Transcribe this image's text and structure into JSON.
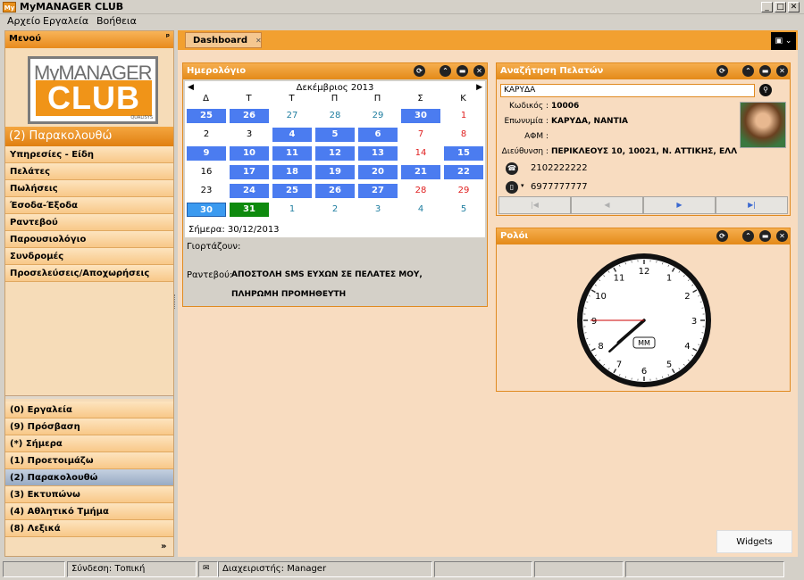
{
  "app": {
    "title": "MyMANAGER CLUB",
    "logo_badge": "My"
  },
  "window_controls": {
    "minimize": "_",
    "maximize": "□",
    "close": "✕"
  },
  "menubar": {
    "items": [
      "Αρχείο",
      "Εργαλεία",
      "Βοήθεια"
    ]
  },
  "sidebar": {
    "title": "Μενού",
    "pin": "ᵖ",
    "logo": {
      "my": "MyMANAGER",
      "club": "CLUB",
      "small": "QUALISYS"
    },
    "section_title": "(2) Παρακολουθώ",
    "items": [
      "Υπηρεσίες - Είδη",
      "Πελάτες",
      "Πωλήσεις",
      "Έσοδα-Έξοδα",
      "Ραντεβού",
      "Παρουσιολόγιο",
      "Συνδρομές",
      "Προσελεύσεις/Αποχωρήσεις"
    ],
    "groups": [
      "(0) Εργαλεία",
      "(9) Πρόσβαση",
      "(*) Σήμερα",
      "(1) Προετοιμάζω",
      "(2) Παρακολουθώ",
      "(3) Εκτυπώνω",
      "(4) Αθλητικό Τμήμα",
      "(8) Λεξικά"
    ],
    "selected_group": "(2) Παρακολουθώ",
    "more": "»"
  },
  "tabs": {
    "active": "Dashboard",
    "close": "✕",
    "menu": "▣ ⌄"
  },
  "calendar": {
    "title": "Ημερολόγιο",
    "month": "Δεκέμβριος 2013",
    "prev": "◀",
    "next": "▶",
    "days_of_week": [
      "Δ",
      "Τ",
      "Τ",
      "Π",
      "Π",
      "Σ",
      "Κ"
    ],
    "weeks": [
      [
        {
          "d": "25",
          "s": "b"
        },
        {
          "d": "26",
          "s": "b"
        },
        {
          "d": "27",
          "s": "teal"
        },
        {
          "d": "28",
          "s": "teal"
        },
        {
          "d": "29",
          "s": "teal"
        },
        {
          "d": "30",
          "s": "b"
        },
        {
          "d": "1",
          "s": "red"
        }
      ],
      [
        {
          "d": "2",
          "s": ""
        },
        {
          "d": "3",
          "s": ""
        },
        {
          "d": "4",
          "s": "b"
        },
        {
          "d": "5",
          "s": "b"
        },
        {
          "d": "6",
          "s": "b"
        },
        {
          "d": "7",
          "s": "red"
        },
        {
          "d": "8",
          "s": "red"
        }
      ],
      [
        {
          "d": "9",
          "s": "b"
        },
        {
          "d": "10",
          "s": "b"
        },
        {
          "d": "11",
          "s": "b"
        },
        {
          "d": "12",
          "s": "b"
        },
        {
          "d": "13",
          "s": "b"
        },
        {
          "d": "14",
          "s": "red"
        },
        {
          "d": "15",
          "s": "b"
        }
      ],
      [
        {
          "d": "16",
          "s": ""
        },
        {
          "d": "17",
          "s": "b"
        },
        {
          "d": "18",
          "s": "b"
        },
        {
          "d": "19",
          "s": "b"
        },
        {
          "d": "20",
          "s": "b"
        },
        {
          "d": "21",
          "s": "b"
        },
        {
          "d": "22",
          "s": "b"
        }
      ],
      [
        {
          "d": "23",
          "s": ""
        },
        {
          "d": "24",
          "s": "b"
        },
        {
          "d": "25",
          "s": "b"
        },
        {
          "d": "26",
          "s": "b"
        },
        {
          "d": "27",
          "s": "b"
        },
        {
          "d": "28",
          "s": "red"
        },
        {
          "d": "29",
          "s": "red"
        }
      ],
      [
        {
          "d": "30",
          "s": "today"
        },
        {
          "d": "31",
          "s": "green"
        },
        {
          "d": "1",
          "s": "teal"
        },
        {
          "d": "2",
          "s": "teal"
        },
        {
          "d": "3",
          "s": "teal"
        },
        {
          "d": "4",
          "s": "teal"
        },
        {
          "d": "5",
          "s": "teal"
        }
      ]
    ],
    "today": "Σήμερα: 30/12/2013",
    "name_days_label": "Γιορτάζουν:",
    "appointments_label": "Ραντεβού:",
    "appointments": [
      "ΑΠΟΣΤΟΛΗ SMS ΕΥΧΩΝ ΣΕ ΠΕΛΑΤΕΣ ΜΟΥ,",
      "ΠΛΗΡΩΜΗ ΠΡΟΜΗΘΕΥΤΗ"
    ]
  },
  "customer_search": {
    "title": "Αναζήτηση Πελατών",
    "query": "ΚΑΡΥΔΑ",
    "code_label": "Κωδικός :",
    "code": "10006",
    "name_label": "Επωνυμία :",
    "name": "ΚΑΡΥΔΑ, ΝΑΝΤΙΑ",
    "afm_label": "ΑΦΜ :",
    "afm": "",
    "address_label": "Διεύθυνση :",
    "address": "ΠΕΡΙΚΛΕΟΥΣ 10, 10021, Ν. ΑΤΤΙΚΗΣ, ΕΛΛ",
    "phone": "2102222222",
    "mobile": "6977777777",
    "nav": [
      "|◀",
      "◀",
      "▶",
      "▶|"
    ]
  },
  "clock": {
    "title": "Ρολόι",
    "label": "MM",
    "hour": 7,
    "minute": 38,
    "second": 45,
    "numbers": [
      "12",
      "1",
      "2",
      "3",
      "4",
      "5",
      "6",
      "7",
      "8",
      "9",
      "10",
      "11"
    ]
  },
  "panel_buttons": [
    "⟳",
    "⌃",
    "▬",
    "✕"
  ],
  "widgets_button": "Widgets",
  "status": {
    "connection": "Σύνδεση: Τοπική",
    "user": "Διαχειριστής: Manager"
  },
  "colors": {
    "accent": "#E88A1C",
    "selected_day": "#4B7CF0",
    "highlight_day": "#0E8A0E",
    "weekend": "#E02020"
  }
}
